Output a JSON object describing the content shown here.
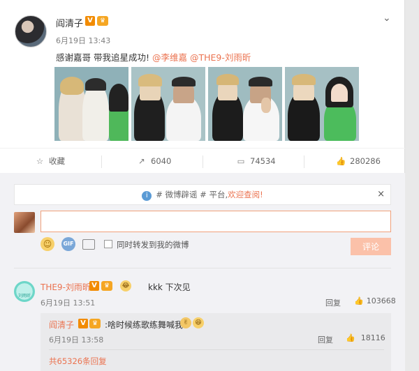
{
  "post": {
    "author": "阎清子",
    "verified_badge": "V",
    "member_badge": "♛",
    "time": "6月19日 13:43",
    "text_prefix": "感谢嘉哥 带我追星成功! ",
    "mention_1": "@李维嘉",
    "mention_2": "@THE9-刘雨昕",
    "photos_count": 4
  },
  "actions": {
    "favorite_label": "收藏",
    "repost_count": "6040",
    "comment_count": "74534",
    "like_count": "280286"
  },
  "comment_box": {
    "notice_prefix": "# 微博辟谣 # 平台,",
    "notice_link": "欢迎查阅!",
    "notice_close": "×",
    "input_value": "",
    "repost_label": "同时转发到我的微博",
    "submit_label": "评论"
  },
  "comments": [
    {
      "author": "THE9-刘雨昕",
      "avatar_text": "刘雨昕",
      "text": "kkk 下次见",
      "time": "6月19日 13:51",
      "reply_label": "回复",
      "likes": "103668",
      "replies": [
        {
          "author": "阎清子",
          "text": ":啥时候练歌练舞喊我",
          "time": "6月19日 13:58",
          "reply_label": "回复",
          "likes": "18116"
        }
      ],
      "more_replies": "共65326条回复"
    }
  ]
}
